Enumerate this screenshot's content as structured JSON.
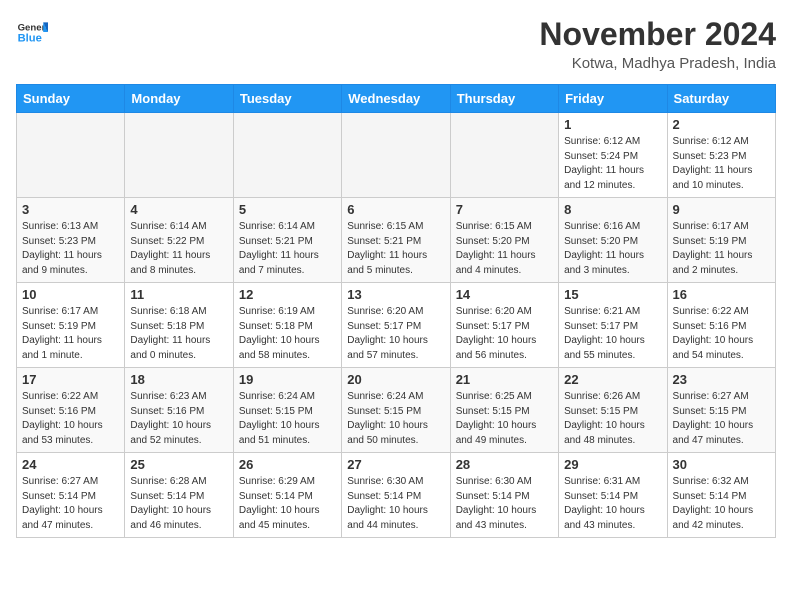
{
  "header": {
    "logo_line1": "General",
    "logo_line2": "Blue",
    "month": "November 2024",
    "location": "Kotwa, Madhya Pradesh, India"
  },
  "weekdays": [
    "Sunday",
    "Monday",
    "Tuesday",
    "Wednesday",
    "Thursday",
    "Friday",
    "Saturday"
  ],
  "weeks": [
    [
      {
        "day": "",
        "info": ""
      },
      {
        "day": "",
        "info": ""
      },
      {
        "day": "",
        "info": ""
      },
      {
        "day": "",
        "info": ""
      },
      {
        "day": "",
        "info": ""
      },
      {
        "day": "1",
        "info": "Sunrise: 6:12 AM\nSunset: 5:24 PM\nDaylight: 11 hours and 12 minutes."
      },
      {
        "day": "2",
        "info": "Sunrise: 6:12 AM\nSunset: 5:23 PM\nDaylight: 11 hours and 10 minutes."
      }
    ],
    [
      {
        "day": "3",
        "info": "Sunrise: 6:13 AM\nSunset: 5:23 PM\nDaylight: 11 hours and 9 minutes."
      },
      {
        "day": "4",
        "info": "Sunrise: 6:14 AM\nSunset: 5:22 PM\nDaylight: 11 hours and 8 minutes."
      },
      {
        "day": "5",
        "info": "Sunrise: 6:14 AM\nSunset: 5:21 PM\nDaylight: 11 hours and 7 minutes."
      },
      {
        "day": "6",
        "info": "Sunrise: 6:15 AM\nSunset: 5:21 PM\nDaylight: 11 hours and 5 minutes."
      },
      {
        "day": "7",
        "info": "Sunrise: 6:15 AM\nSunset: 5:20 PM\nDaylight: 11 hours and 4 minutes."
      },
      {
        "day": "8",
        "info": "Sunrise: 6:16 AM\nSunset: 5:20 PM\nDaylight: 11 hours and 3 minutes."
      },
      {
        "day": "9",
        "info": "Sunrise: 6:17 AM\nSunset: 5:19 PM\nDaylight: 11 hours and 2 minutes."
      }
    ],
    [
      {
        "day": "10",
        "info": "Sunrise: 6:17 AM\nSunset: 5:19 PM\nDaylight: 11 hours and 1 minute."
      },
      {
        "day": "11",
        "info": "Sunrise: 6:18 AM\nSunset: 5:18 PM\nDaylight: 11 hours and 0 minutes."
      },
      {
        "day": "12",
        "info": "Sunrise: 6:19 AM\nSunset: 5:18 PM\nDaylight: 10 hours and 58 minutes."
      },
      {
        "day": "13",
        "info": "Sunrise: 6:20 AM\nSunset: 5:17 PM\nDaylight: 10 hours and 57 minutes."
      },
      {
        "day": "14",
        "info": "Sunrise: 6:20 AM\nSunset: 5:17 PM\nDaylight: 10 hours and 56 minutes."
      },
      {
        "day": "15",
        "info": "Sunrise: 6:21 AM\nSunset: 5:17 PM\nDaylight: 10 hours and 55 minutes."
      },
      {
        "day": "16",
        "info": "Sunrise: 6:22 AM\nSunset: 5:16 PM\nDaylight: 10 hours and 54 minutes."
      }
    ],
    [
      {
        "day": "17",
        "info": "Sunrise: 6:22 AM\nSunset: 5:16 PM\nDaylight: 10 hours and 53 minutes."
      },
      {
        "day": "18",
        "info": "Sunrise: 6:23 AM\nSunset: 5:16 PM\nDaylight: 10 hours and 52 minutes."
      },
      {
        "day": "19",
        "info": "Sunrise: 6:24 AM\nSunset: 5:15 PM\nDaylight: 10 hours and 51 minutes."
      },
      {
        "day": "20",
        "info": "Sunrise: 6:24 AM\nSunset: 5:15 PM\nDaylight: 10 hours and 50 minutes."
      },
      {
        "day": "21",
        "info": "Sunrise: 6:25 AM\nSunset: 5:15 PM\nDaylight: 10 hours and 49 minutes."
      },
      {
        "day": "22",
        "info": "Sunrise: 6:26 AM\nSunset: 5:15 PM\nDaylight: 10 hours and 48 minutes."
      },
      {
        "day": "23",
        "info": "Sunrise: 6:27 AM\nSunset: 5:15 PM\nDaylight: 10 hours and 47 minutes."
      }
    ],
    [
      {
        "day": "24",
        "info": "Sunrise: 6:27 AM\nSunset: 5:14 PM\nDaylight: 10 hours and 47 minutes."
      },
      {
        "day": "25",
        "info": "Sunrise: 6:28 AM\nSunset: 5:14 PM\nDaylight: 10 hours and 46 minutes."
      },
      {
        "day": "26",
        "info": "Sunrise: 6:29 AM\nSunset: 5:14 PM\nDaylight: 10 hours and 45 minutes."
      },
      {
        "day": "27",
        "info": "Sunrise: 6:30 AM\nSunset: 5:14 PM\nDaylight: 10 hours and 44 minutes."
      },
      {
        "day": "28",
        "info": "Sunrise: 6:30 AM\nSunset: 5:14 PM\nDaylight: 10 hours and 43 minutes."
      },
      {
        "day": "29",
        "info": "Sunrise: 6:31 AM\nSunset: 5:14 PM\nDaylight: 10 hours and 43 minutes."
      },
      {
        "day": "30",
        "info": "Sunrise: 6:32 AM\nSunset: 5:14 PM\nDaylight: 10 hours and 42 minutes."
      }
    ]
  ]
}
